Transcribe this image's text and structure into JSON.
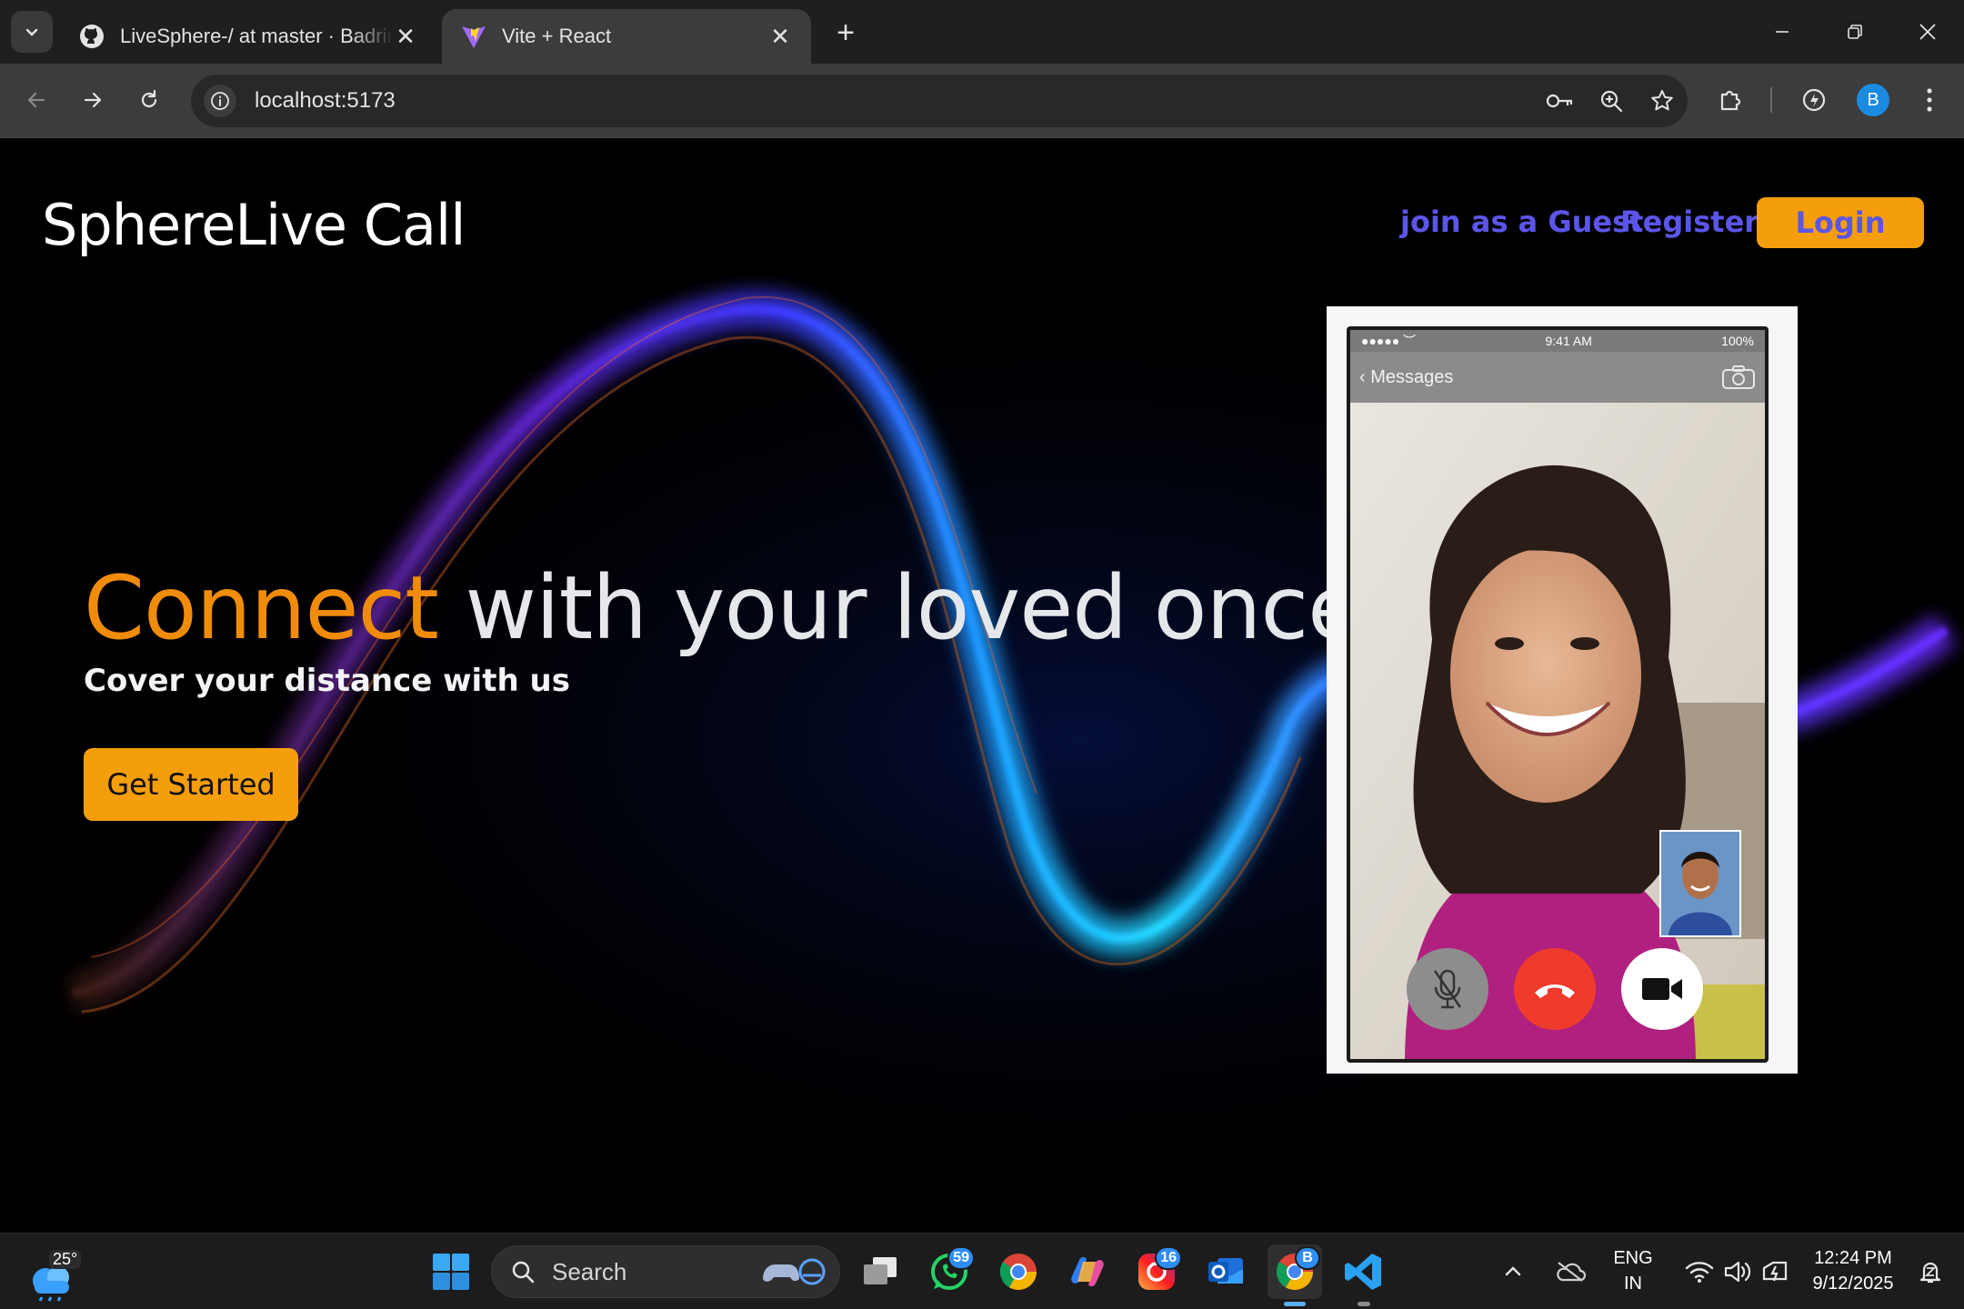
{
  "browser": {
    "tabs": [
      {
        "title": "LiveSphere-/ at master · Badrinath",
        "favicon": "github-icon",
        "active": false
      },
      {
        "title": "Vite + React",
        "favicon": "vite-icon",
        "active": true
      }
    ],
    "url": "localhost:5173",
    "profile_initial": "B"
  },
  "page": {
    "brand": "SphereLive Call",
    "nav": {
      "guest": "join as a Guest",
      "register": "Register",
      "login": "Login"
    },
    "hero": {
      "title_accent": "Connect",
      "title_rest": " with your loved once",
      "subtitle": "Cover your distance with us",
      "cta": "Get Started"
    },
    "phone": {
      "time": "9:41 AM",
      "battery": "100%",
      "back_label": "Messages"
    }
  },
  "taskbar": {
    "weather_temp": "25°",
    "search_placeholder": "Search",
    "whatsapp_badge": "59",
    "instagram_badge": "16",
    "chrome_profile": "B",
    "lang_top": "ENG",
    "lang_bottom": "IN",
    "time": "12:24 PM",
    "date": "9/12/2025"
  },
  "colors": {
    "accent_orange": "#f59e0b",
    "nav_purple": "#5b55ea",
    "background": "#000000"
  }
}
